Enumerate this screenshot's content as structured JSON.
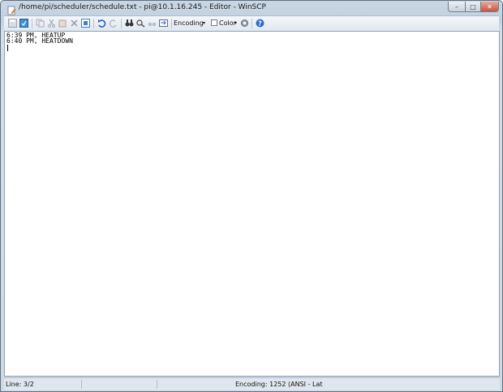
{
  "window": {
    "title": "/home/pi/scheduler/schedule.txt - pi@10.1.16.245 - Editor - WinSCP",
    "controls": {
      "minimize": "–",
      "maximize": "□",
      "close": "✕"
    }
  },
  "toolbar": {
    "encoding_label": "Encoding",
    "color_label": "Color",
    "icons": [
      "save-icon",
      "reload-icon",
      "copy-icon",
      "cut-icon",
      "paste-icon",
      "delete-icon",
      "select-all-icon",
      "undo-icon",
      "redo-icon",
      "find-icon",
      "replace-icon",
      "find-next-icon",
      "goto-line-icon",
      "dropdown-arrow-icon",
      "settings-icon",
      "help-icon"
    ]
  },
  "editor": {
    "lines": [
      "6:39 PM, HEATUP",
      "6:40 PM, HEATDOWN"
    ]
  },
  "status": {
    "line": "Line: 3/2",
    "encoding": "Encoding: 1252  (ANSI - Lat"
  },
  "colors": {
    "help": "#2c6bd1",
    "undo": "#1f5fbf",
    "close": "#c8543f"
  }
}
